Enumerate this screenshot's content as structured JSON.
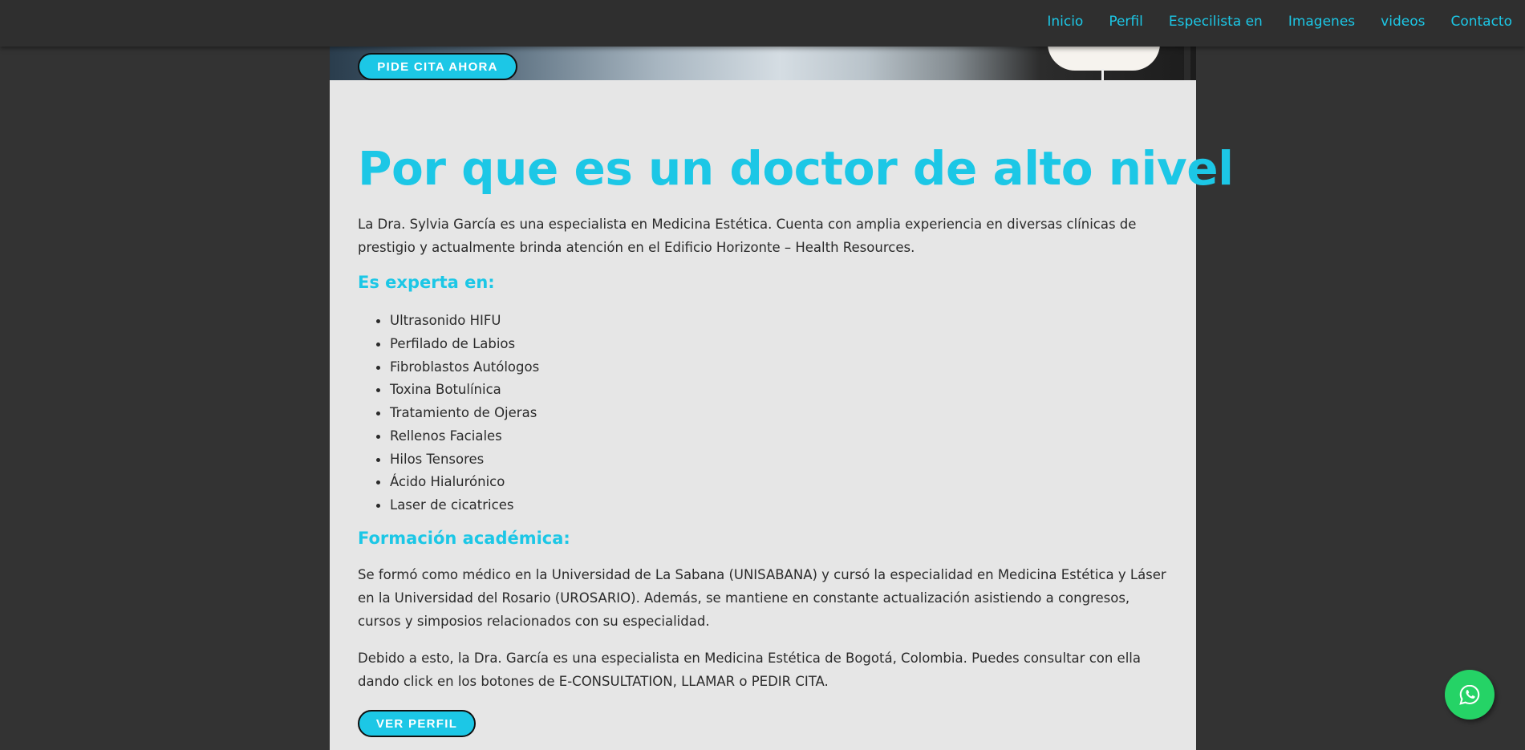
{
  "nav": {
    "items": [
      {
        "label": "Inicio"
      },
      {
        "label": "Perfil"
      },
      {
        "label": "Especilista en"
      },
      {
        "label": "Imagenes"
      },
      {
        "label": "videos"
      },
      {
        "label": "Contacto"
      }
    ]
  },
  "hero": {
    "cta_label": "PIDE CITA AHORA"
  },
  "content": {
    "title": "Por que es un doctor de alto nivel",
    "intro": "La Dra. Sylvia García es una especialista en Medicina Estética. Cuenta con amplia experiencia en diversas clínicas de prestigio y actualmente brinda atención en el Edificio Horizonte – Health Resources.",
    "expert_heading": "Es experta en:",
    "expertise": [
      "Ultrasonido HIFU",
      "Perfilado de Labios",
      "Fibroblastos Autólogos",
      "Toxina Botulínica",
      "Tratamiento de Ojeras",
      "Rellenos Faciales",
      "Hilos Tensores",
      "Ácido Hialurónico",
      "Laser de cicatrices"
    ],
    "education_heading": "Formación académica:",
    "education_text": "Se formó como médico en la Universidad de La Sabana (UNISABANA) y cursó la especialidad en Medicina Estética y Láser en la Universidad del Rosario (UROSARIO). Además, se mantiene en constante actualización asistiendo a congresos, cursos y simposios relacionados con su especialidad.",
    "closing_text": "Debido a esto, la Dra. García es una especialista en Medicina Estética de Bogotá, Colombia. Puedes consultar con ella dando click en los botones de E-CONSULTATION, LLAMAR o PEDIR CITA.",
    "profile_button": "VER PERFIL"
  },
  "colors": {
    "accent": "#1cc7e6",
    "background": "#333333",
    "panel": "#e6e6e6",
    "whatsapp": "#25d366"
  },
  "icons": {
    "floating": "whatsapp-icon"
  }
}
